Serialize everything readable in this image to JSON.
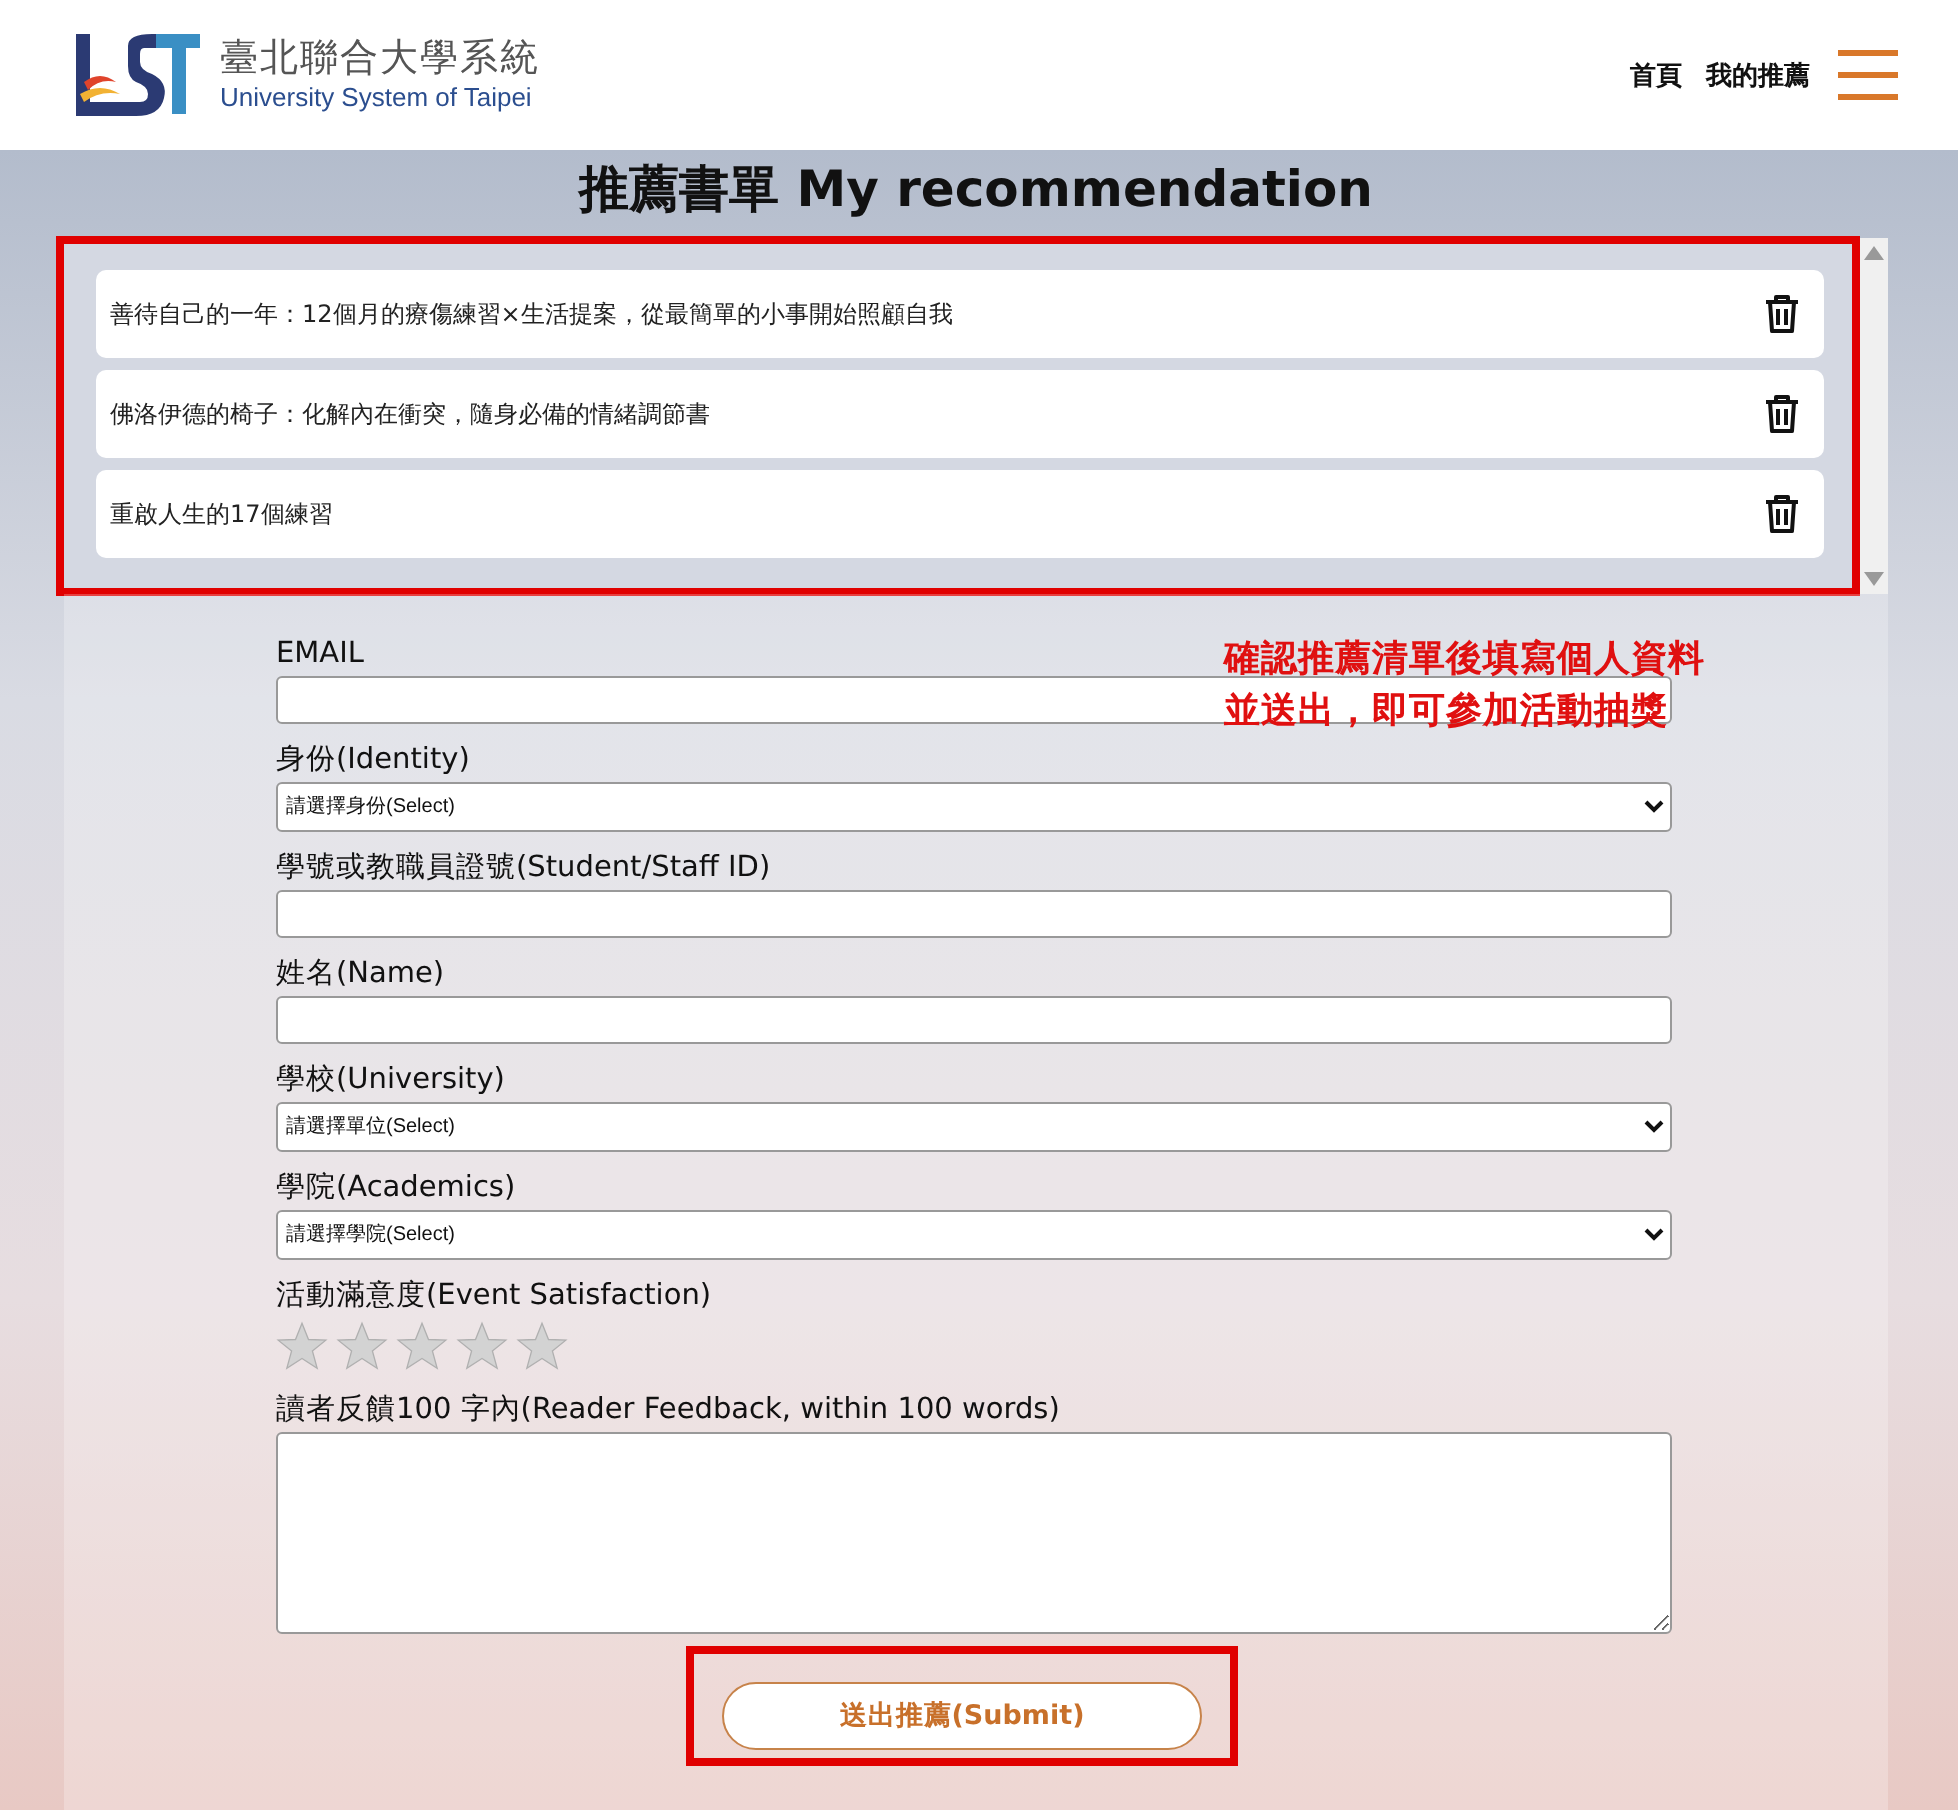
{
  "header": {
    "logo_title": "臺北聯合大學系統",
    "logo_subtitle": "University System of Taipei",
    "nav": [
      "首頁",
      "我的推薦"
    ]
  },
  "title": "推薦書單 My recommendation",
  "books": [
    {
      "title": "善待自己的一年：12個月的療傷練習×生活提案，從最簡單的小事開始照顧自我"
    },
    {
      "title": "佛洛伊德的椅子：化解內在衝突，隨身必備的情緒調節書"
    },
    {
      "title": "重啟人生的17個練習"
    }
  ],
  "note": [
    "確認推薦清單後填寫個人資料",
    "並送出，即可參加活動抽獎"
  ],
  "fields": [
    {
      "kind": "text",
      "label": "EMAIL"
    },
    {
      "kind": "select",
      "label": "身份(Identity)",
      "value": "請選擇身份(Select)"
    },
    {
      "kind": "text",
      "label": "學號或教職員證號(Student/Staff ID)"
    },
    {
      "kind": "text",
      "label": "姓名(Name)"
    },
    {
      "kind": "select",
      "label": "學校(University)",
      "value": "請選擇單位(Select)"
    },
    {
      "kind": "select",
      "label": "學院(Academics)",
      "value": "請選擇學院(Select)"
    },
    {
      "kind": "rating",
      "label": "活動滿意度(Event Satisfaction)",
      "stars": 0
    },
    {
      "kind": "textarea",
      "label": "讀者反饋100 字內(Reader Feedback, within 100 words)"
    }
  ],
  "submit": "送出推薦(Submit)"
}
